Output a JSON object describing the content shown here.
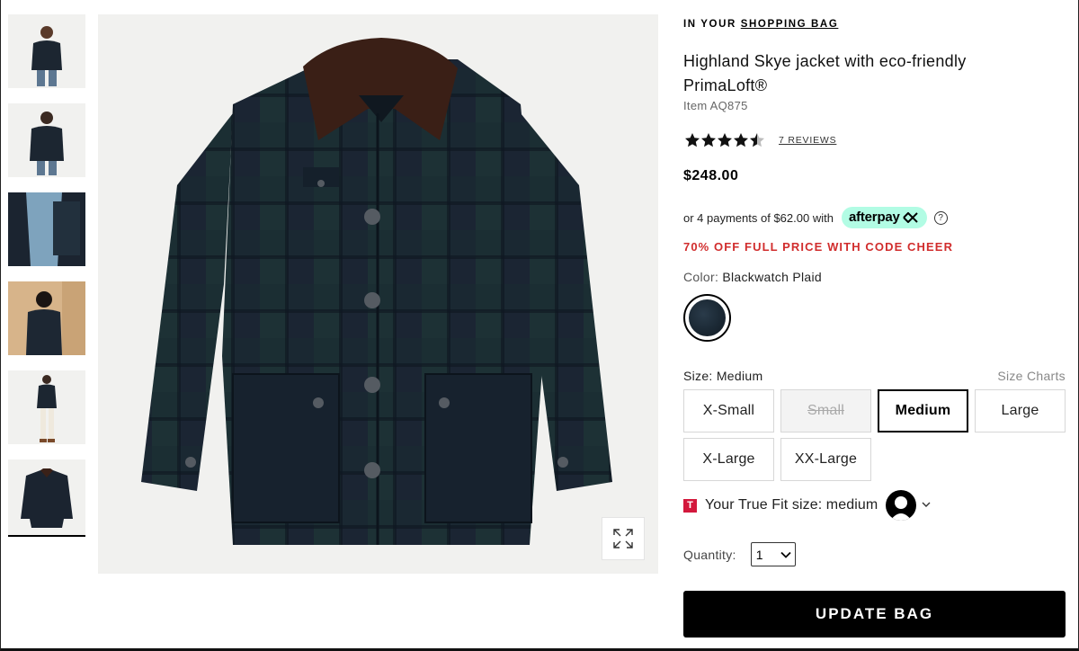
{
  "thumbnails": [
    {
      "alt": "model-front"
    },
    {
      "alt": "model-back"
    },
    {
      "alt": "lining-detail"
    },
    {
      "alt": "model-styled"
    },
    {
      "alt": "model-full"
    },
    {
      "alt": "jacket-flat"
    }
  ],
  "product": {
    "in_bag_prefix": "IN YOUR ",
    "in_bag_link": "SHOPPING BAG",
    "title": "Highland Skye jacket with eco-friendly PrimaLoft®",
    "item_number": "Item AQ875",
    "rating": 4.5,
    "reviews_label": "7 REVIEWS",
    "price": "$248.00",
    "afterpay_text": "or 4 payments of $62.00 with",
    "afterpay_brand": "afterpay",
    "info_symbol": "?",
    "promo": "70% OFF FULL PRICE WITH CODE CHEER",
    "color_key": "Color:",
    "color_value": "Blackwatch Plaid",
    "size_key": "Size:",
    "size_value": "Medium",
    "size_charts": "Size Charts",
    "sizes": [
      {
        "label": "X-Small",
        "state": "available"
      },
      {
        "label": "Small",
        "state": "disabled"
      },
      {
        "label": "Medium",
        "state": "selected"
      },
      {
        "label": "Large",
        "state": "available"
      },
      {
        "label": "X-Large",
        "state": "available"
      },
      {
        "label": "XX-Large",
        "state": "available"
      }
    ],
    "truefit_logo": "T",
    "truefit_text": "Your True Fit size: medium",
    "quantity_label": "Quantity:",
    "quantity_value": "1",
    "update_button": "UPDATE BAG"
  },
  "colors": {
    "promo_red": "#d12d2d",
    "afterpay_mint": "#b2fce4",
    "truefit_red": "#d3183c",
    "button_black": "#000000"
  }
}
